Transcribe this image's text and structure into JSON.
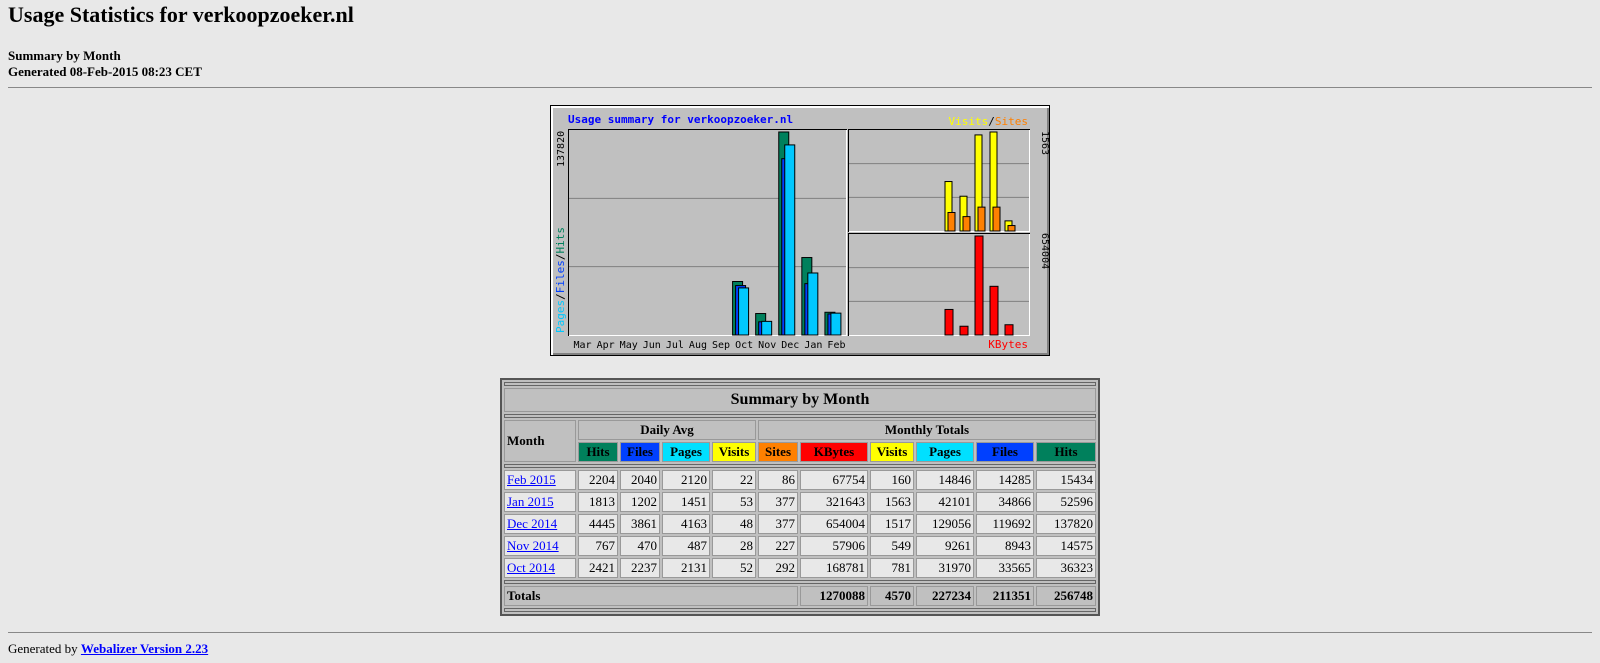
{
  "page": {
    "title": "Usage Statistics for verkoopzoeker.nl",
    "subtitle": "Summary by Month",
    "generated": "Generated 08-Feb-2015 08:23 CET"
  },
  "graph": {
    "title": "Usage summary for verkoopzoeker.nl",
    "left_axis_label": {
      "pages": "Pages",
      "files": "Files",
      "hits": "Hits",
      "sep": "/"
    },
    "right_top_label": {
      "visits": "Visits",
      "sites": "Sites",
      "sep": "/"
    },
    "right_bottom_label": "KBytes",
    "left_max_label": "137820",
    "top_right_max_label": "1563",
    "bottom_right_max_label": "654004",
    "colors": {
      "hits": "#00805c",
      "files": "#0040ff",
      "pages": "#00c8ff",
      "visits": "#ffff00",
      "sites": "#ff8000",
      "kbytes": "#ff0000",
      "title": "#0000ff",
      "panel": "#c0c0c0"
    }
  },
  "chart_data": {
    "type": "bar",
    "categories": [
      "Mar",
      "Apr",
      "May",
      "Jun",
      "Jul",
      "Aug",
      "Sep",
      "Oct",
      "Nov",
      "Dec",
      "Jan",
      "Feb"
    ],
    "series": [
      {
        "name": "Hits",
        "values": [
          0,
          0,
          0,
          0,
          0,
          0,
          0,
          36323,
          14575,
          137820,
          52596,
          15434
        ]
      },
      {
        "name": "Files",
        "values": [
          0,
          0,
          0,
          0,
          0,
          0,
          0,
          33565,
          8943,
          119692,
          34866,
          14285
        ]
      },
      {
        "name": "Pages",
        "values": [
          0,
          0,
          0,
          0,
          0,
          0,
          0,
          31970,
          9261,
          129056,
          42101,
          14846
        ]
      },
      {
        "name": "Visits",
        "values": [
          0,
          0,
          0,
          0,
          0,
          0,
          0,
          781,
          549,
          1517,
          1563,
          160
        ]
      },
      {
        "name": "Sites",
        "values": [
          0,
          0,
          0,
          0,
          0,
          0,
          0,
          292,
          227,
          377,
          377,
          86
        ]
      },
      {
        "name": "KBytes",
        "values": [
          0,
          0,
          0,
          0,
          0,
          0,
          0,
          168781,
          57906,
          654004,
          321643,
          67754
        ]
      }
    ],
    "ylim_main": [
      0,
      137820
    ],
    "ylim_visits": [
      0,
      1563
    ],
    "ylim_kbytes": [
      0,
      654004
    ],
    "grid": true
  },
  "table": {
    "title": "Summary by Month",
    "month_header": "Month",
    "daily_avg_header": "Daily Avg",
    "monthly_totals_header": "Monthly Totals",
    "daily_cols": [
      {
        "label": "Hits",
        "color": "#00805c",
        "text": "#000000"
      },
      {
        "label": "Files",
        "color": "#0040ff",
        "text": "#000000"
      },
      {
        "label": "Pages",
        "color": "#00e0ff",
        "text": "#000000"
      },
      {
        "label": "Visits",
        "color": "#ffff00",
        "text": "#000000"
      }
    ],
    "monthly_cols": [
      {
        "label": "Sites",
        "color": "#ff8000",
        "text": "#000000"
      },
      {
        "label": "KBytes",
        "color": "#ff0000",
        "text": "#000000"
      },
      {
        "label": "Visits",
        "color": "#ffff00",
        "text": "#000000"
      },
      {
        "label": "Pages",
        "color": "#00e0ff",
        "text": "#000000"
      },
      {
        "label": "Files",
        "color": "#0040ff",
        "text": "#000000"
      },
      {
        "label": "Hits",
        "color": "#00805c",
        "text": "#000000"
      }
    ],
    "rows": [
      {
        "month": "Feb 2015",
        "cells": [
          "2204",
          "2040",
          "2120",
          "22",
          "86",
          "67754",
          "160",
          "14846",
          "14285",
          "15434"
        ]
      },
      {
        "month": "Jan 2015",
        "cells": [
          "1813",
          "1202",
          "1451",
          "53",
          "377",
          "321643",
          "1563",
          "42101",
          "34866",
          "52596"
        ]
      },
      {
        "month": "Dec 2014",
        "cells": [
          "4445",
          "3861",
          "4163",
          "48",
          "377",
          "654004",
          "1517",
          "129056",
          "119692",
          "137820"
        ]
      },
      {
        "month": "Nov 2014",
        "cells": [
          "767",
          "470",
          "487",
          "28",
          "227",
          "57906",
          "549",
          "9261",
          "8943",
          "14575"
        ]
      },
      {
        "month": "Oct 2014",
        "cells": [
          "2421",
          "2237",
          "2131",
          "52",
          "292",
          "168781",
          "781",
          "31970",
          "33565",
          "36323"
        ]
      }
    ],
    "totals_label": "Totals",
    "totals": [
      "1270088",
      "4570",
      "227234",
      "211351",
      "256748"
    ]
  },
  "footer": {
    "prefix": "Generated by",
    "link_text": "Webalizer Version 2.23"
  }
}
